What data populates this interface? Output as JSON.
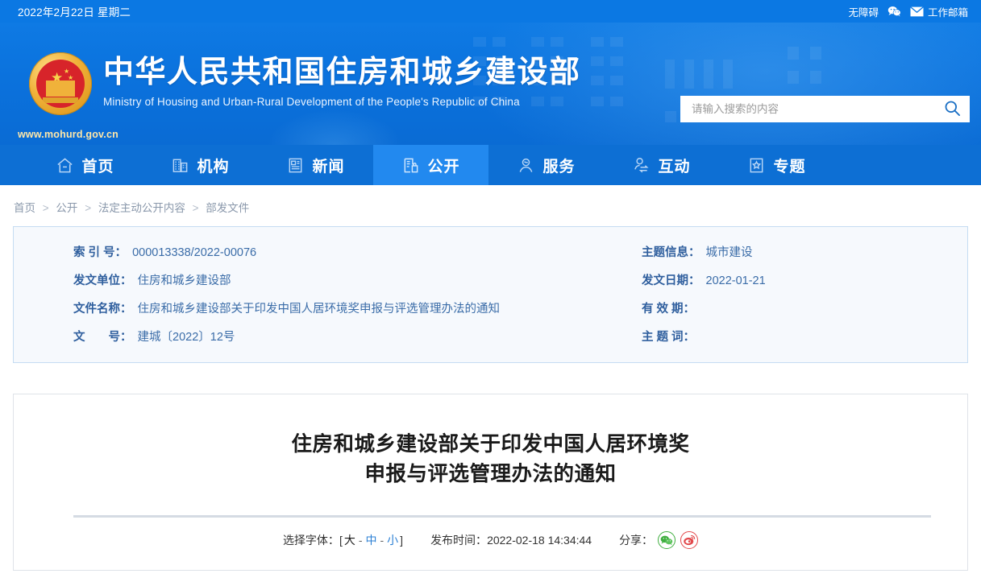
{
  "topbar": {
    "date": "2022年2月22日 星期二",
    "accessibility_label": "无障碍",
    "wechat_icon": "wechat-icon",
    "mail_icon": "mail-icon",
    "mail_label": "工作邮箱"
  },
  "banner": {
    "title_cn": "中华人民共和国住房和城乡建设部",
    "title_en": "Ministry of Housing and Urban-Rural Development of the People's Republic of China",
    "site_url": "www.mohurd.gov.cn",
    "emblem_icon": "national-emblem-icon"
  },
  "search": {
    "placeholder": "请输入搜索的内容",
    "value": "",
    "icon": "search-icon"
  },
  "nav": {
    "items": [
      {
        "label": "首页",
        "icon": "home-icon",
        "active": false
      },
      {
        "label": "机构",
        "icon": "building-icon",
        "active": false
      },
      {
        "label": "新闻",
        "icon": "news-document-icon",
        "active": false
      },
      {
        "label": "公开",
        "icon": "open-info-icon",
        "active": true
      },
      {
        "label": "服务",
        "icon": "service-person-icon",
        "active": false
      },
      {
        "label": "互动",
        "icon": "interaction-person-icon",
        "active": false
      },
      {
        "label": "专题",
        "icon": "star-book-icon",
        "active": false
      }
    ]
  },
  "breadcrumb": {
    "items": [
      "首页",
      "公开",
      "法定主动公开内容",
      "部发文件"
    ],
    "separator": ">"
  },
  "info": {
    "rows": [
      {
        "left_label": "索 引 号：",
        "left_value": "000013338/2022-00076",
        "right_label": "主题信息：",
        "right_value": "城市建设"
      },
      {
        "left_label": "发文单位：",
        "left_value": "住房和城乡建设部",
        "right_label": "发文日期：",
        "right_value": "2022-01-21"
      },
      {
        "left_label": "文件名称：",
        "left_value": "住房和城乡建设部关于印发中国人居环境奖申报与评选管理办法的通知",
        "right_label": "有 效 期：",
        "right_value": ""
      },
      {
        "left_label": "文　　号：",
        "left_value": "建城〔2022〕12号",
        "right_label": "主 题 词：",
        "right_value": ""
      }
    ]
  },
  "document": {
    "title_line1": "住房和城乡建设部关于印发中国人居环境奖",
    "title_line2": "申报与评选管理办法的通知"
  },
  "toolbar": {
    "fontsize_label": "选择字体：",
    "bracket_open": "[",
    "bracket_close": "]",
    "fontsize_big": "大",
    "fontsize_mid": "中",
    "fontsize_small": "小",
    "dash": "-",
    "publish_label": "发布时间：",
    "publish_time": "2022-02-18 14:34:44",
    "share_label": "分享：",
    "share_wechat_icon": "wechat-share-icon",
    "share_weibo_icon": "weibo-share-icon"
  },
  "colors": {
    "brand_blue": "#0b78e3",
    "nav_blue": "#0d6fd4",
    "nav_active": "#2289ef",
    "info_bg": "#f6f9fd",
    "info_border": "#c5dcf2",
    "label_blue": "#2f5f9e",
    "link_blue": "#2a7fd4",
    "wechat_green": "#3fae3f",
    "weibo_red": "#e2484b"
  }
}
